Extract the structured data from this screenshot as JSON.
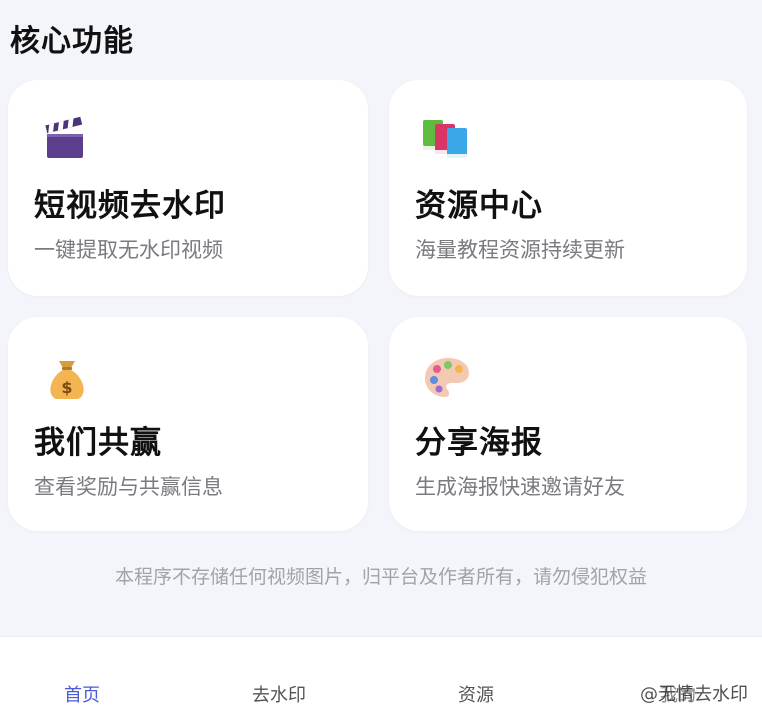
{
  "section": {
    "title": "核心功能"
  },
  "cards": [
    {
      "icon": "clapperboard-icon",
      "title": "短视频去水印",
      "desc": "一键提取无水印视频"
    },
    {
      "icon": "books-icon",
      "title": "资源中心",
      "desc": "海量教程资源持续更新"
    },
    {
      "icon": "money-bag-icon",
      "title": "我们共赢",
      "desc": "查看奖励与共赢信息"
    },
    {
      "icon": "palette-icon",
      "title": "分享海报",
      "desc": "生成海报快速邀请好友"
    }
  ],
  "footer": {
    "note": "本程序不存储任何视频图片，归平台及作者所有，请勿侵犯权益"
  },
  "tabbar": {
    "items": [
      {
        "label": "首页",
        "active": true
      },
      {
        "label": "去水印",
        "active": false
      },
      {
        "label": "资源",
        "active": false
      },
      {
        "label": "我的",
        "active": false
      }
    ]
  },
  "watermark": "@无情去水印",
  "colors": {
    "accent": "#4a5bd6",
    "background": "#f3f5fa",
    "card": "#ffffff"
  }
}
